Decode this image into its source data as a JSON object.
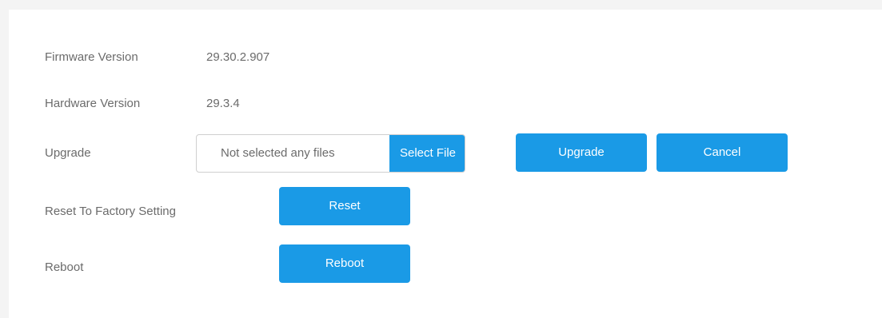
{
  "form": {
    "firmware": {
      "label": "Firmware Version",
      "value": "29.30.2.907"
    },
    "hardware": {
      "label": "Hardware Version",
      "value": "29.3.4"
    },
    "upgrade": {
      "label": "Upgrade",
      "file_placeholder": "Not selected any files",
      "select_file_label": "Select File",
      "upgrade_button": "Upgrade",
      "cancel_button": "Cancel"
    },
    "reset": {
      "label": "Reset To Factory Setting",
      "button": "Reset"
    },
    "reboot": {
      "label": "Reboot",
      "button": "Reboot"
    }
  },
  "colors": {
    "accent": "#1a9ae6",
    "text": "#6b6b6b",
    "border": "#cfcfcf"
  }
}
